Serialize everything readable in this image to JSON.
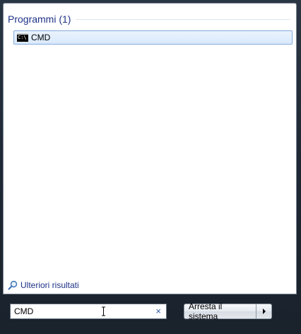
{
  "results": {
    "section_title": "Programmi (1)",
    "items": [
      {
        "label": "CMD",
        "icon": "command-prompt-icon"
      }
    ],
    "more_results_label": "Ulteriori risultati",
    "more_results_icon": "magnifier-icon"
  },
  "search": {
    "value": "CMD",
    "clear_glyph": "×"
  },
  "shutdown": {
    "label": "Arresta il sistema",
    "arrow_icon": "right-arrow-icon"
  },
  "colors": {
    "section_title": "#1e3287",
    "selection_border": "#84acdd",
    "selection_fill": "#dae9fb",
    "frame": "#1f2a38"
  }
}
